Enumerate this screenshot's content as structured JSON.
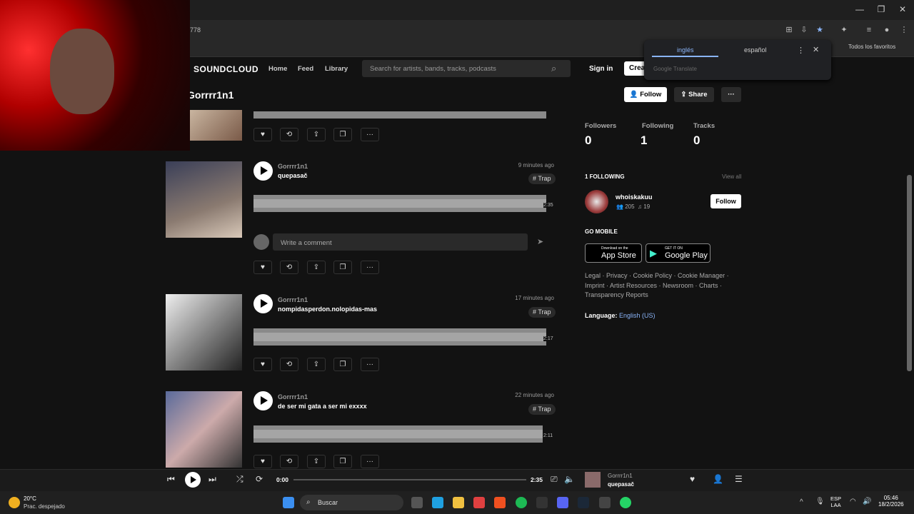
{
  "browser": {
    "url_fragment": "778",
    "bookmark": "Todos los favoritos"
  },
  "translate": {
    "tab_en": "inglés",
    "tab_es": "español",
    "footer": "Google Translate"
  },
  "nav": {
    "logo": "SOUNDCLOUD",
    "home": "Home",
    "feed": "Feed",
    "library": "Library",
    "search_placeholder": "Search for artists, bands, tracks, podcasts",
    "sign_in": "Sign in",
    "create": "Crea"
  },
  "profile": {
    "name": "Gorrrr1n1",
    "follow": "Follow",
    "share": "Share",
    "more": "···"
  },
  "tracks": [
    {
      "artist": "Gorrrr1n1",
      "title": "quepasač",
      "ago": "9 minutes ago",
      "tag": "# Trap",
      "duration": "2:35"
    },
    {
      "artist": "Gorrrr1n1",
      "title": "nompidasperdon.nolopidas-mas",
      "ago": "17 minutes ago",
      "tag": "# Trap",
      "duration": "2:17"
    },
    {
      "artist": "Gorrrr1n1",
      "title": "de ser mi gata a ser mi exxxx",
      "ago": "22 minutes ago",
      "tag": "# Trap",
      "duration": "2:11"
    }
  ],
  "comment": {
    "placeholder": "Write a comment"
  },
  "stats": {
    "followers_label": "Followers",
    "followers": "0",
    "following_label": "Following",
    "following": "1",
    "tracks_label": "Tracks",
    "tracks": "0"
  },
  "following": {
    "header": "1 FOLLOWING",
    "view_all": "View all",
    "user": "whoiskakuu",
    "followers": "205",
    "tracks": "19",
    "follow": "Follow"
  },
  "mobile": {
    "header": "GO MOBILE",
    "appstore_small": "Download on the",
    "appstore": "App Store",
    "gplay_small": "GET IT ON",
    "gplay": "Google Play"
  },
  "footer": {
    "links": "Legal · Privacy · Cookie Policy · Cookie Manager · Imprint · Artist Resources · Newsroom · Charts · Transparency Reports",
    "language_label": "Language:",
    "language": "English (US)"
  },
  "player": {
    "current": "0:00",
    "total": "2:35",
    "artist": "Gorrrr1n1",
    "title": "quepasač"
  },
  "taskbar": {
    "temp": "20°C",
    "weather": "Prac. despejado",
    "search": "Buscar",
    "lang1": "ESP",
    "lang2": "LAA",
    "time": "05:46",
    "date": "18/2/2026"
  }
}
